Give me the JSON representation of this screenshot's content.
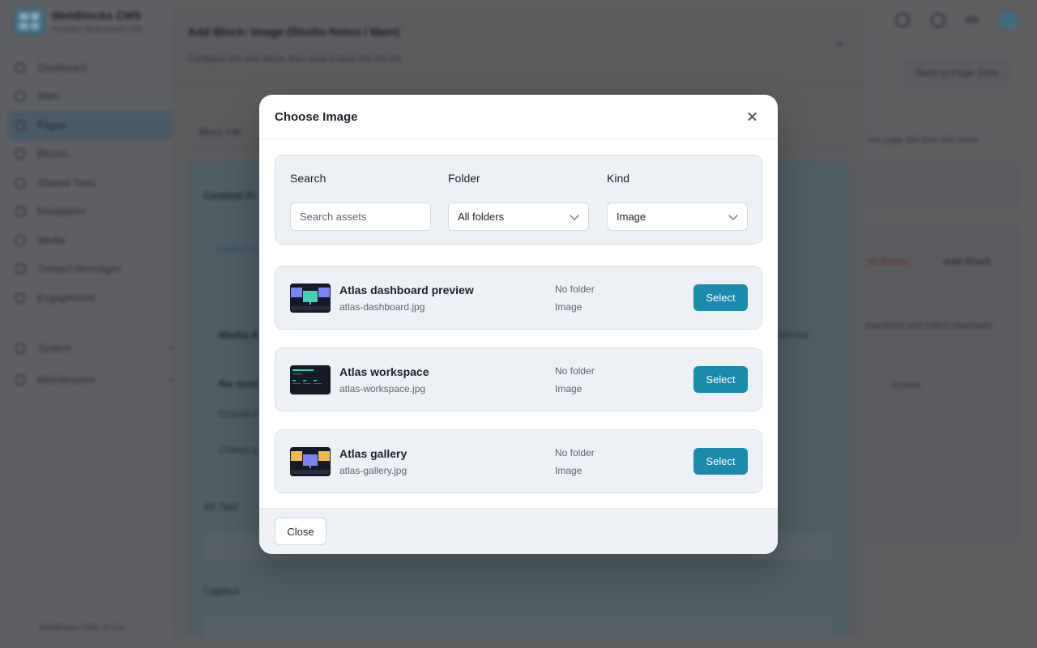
{
  "app": {
    "brand_title": "WebBlocks CMS",
    "brand_sub": "A modern block-based CMS",
    "version": "WebBlocks CMS v0.0.9",
    "lang": "EN",
    "nav": [
      {
        "label": "Dashboard",
        "icon": "dashboard-icon"
      },
      {
        "label": "Sites",
        "icon": "globe-icon"
      },
      {
        "label": "Pages",
        "icon": "page-icon",
        "active": true
      },
      {
        "label": "Blocks",
        "icon": "blocks-icon"
      },
      {
        "label": "Shared Slots",
        "icon": "slots-icon"
      },
      {
        "label": "Navigation",
        "icon": "navigation-icon"
      },
      {
        "label": "Media",
        "icon": "media-icon"
      },
      {
        "label": "Contact Messages",
        "icon": "mail-icon"
      },
      {
        "label": "Engagement",
        "icon": "engagement-icon"
      }
    ],
    "nav_groups": [
      {
        "label": "System",
        "icon": "system-icon"
      },
      {
        "label": "Maintenance",
        "icon": "wrench-icon"
      }
    ],
    "back_button": "Back to Page Slots",
    "hint_text": "the page slot and slot name.",
    "all_blocks": "All Blocks",
    "add_block": "Add Block",
    "desc_text": "populated and edited separately.",
    "actions_header": "Actions"
  },
  "outer_modal": {
    "title": "Add Block: Image (Studio Notes / Main)",
    "subtitle": "Configure the new block, then save it back into the list.",
    "tab": "Block Info",
    "content_title": "Content Fi",
    "caption_tag": "Caption a",
    "media_title": "Media A",
    "remove_label": "Remove",
    "no_asset": "No asse",
    "choose_1": "Choose a",
    "choose_2": "Choose a",
    "alt_text_label": "Alt Text",
    "caption_label": "Caption"
  },
  "modal": {
    "title": "Choose Image",
    "filters": {
      "search_label": "Search",
      "search_placeholder": "Search assets",
      "folder_label": "Folder",
      "folder_value": "All folders",
      "kind_label": "Kind",
      "kind_value": "Image"
    },
    "assets": [
      {
        "name": "Atlas dashboard preview",
        "file": "atlas-dashboard.jpg",
        "folder": "No folder",
        "kind": "Image",
        "select_label": "Select"
      },
      {
        "name": "Atlas workspace",
        "file": "atlas-workspace.jpg",
        "folder": "No folder",
        "kind": "Image",
        "select_label": "Select"
      },
      {
        "name": "Atlas gallery",
        "file": "atlas-gallery.jpg",
        "folder": "No folder",
        "kind": "Image",
        "select_label": "Select"
      }
    ],
    "close_label": "Close"
  },
  "colors": {
    "primary": "#1a8aad",
    "panel": "#edf0f5"
  }
}
